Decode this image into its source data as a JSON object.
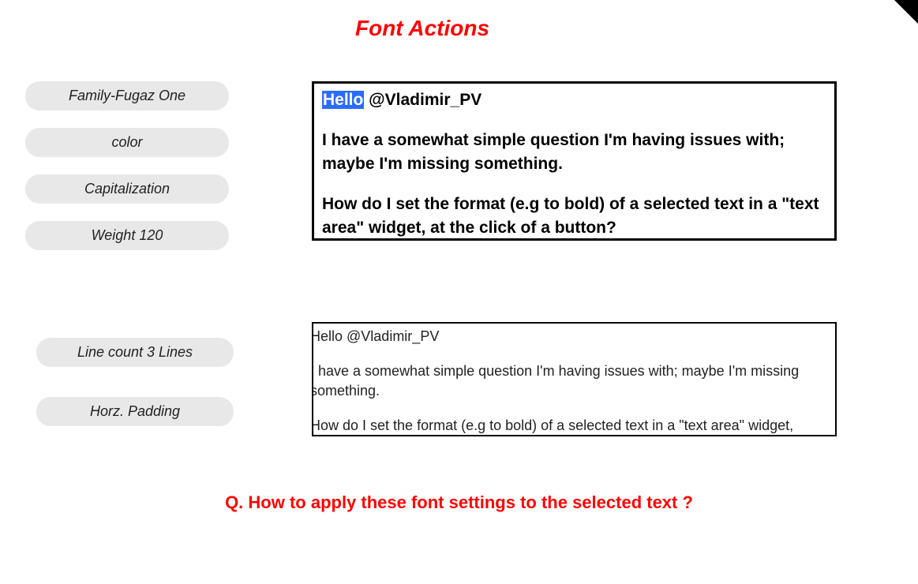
{
  "header": {
    "title": "Font Actions"
  },
  "sidebar_top": {
    "items": [
      {
        "label": "Family-Fugaz One"
      },
      {
        "label": "color"
      },
      {
        "label": "Capitalization"
      },
      {
        "label": "Weight 120"
      }
    ]
  },
  "sidebar_bottom": {
    "items": [
      {
        "label": "Line count 3 Lines"
      },
      {
        "label": "Horz. Padding"
      }
    ]
  },
  "textbox1": {
    "highlighted": "Hello",
    "mention": " @Vladimir_PV",
    "para2": "I have a somewhat simple question I'm having issues with; maybe I'm missing something.",
    "para3": "How do I set the format (e.g to bold) of a selected text in a \"text area\" widget, at the click of a button?"
  },
  "textbox2": {
    "para1": "Hello @Vladimir_PV",
    "para2": "I have a somewhat simple question I'm having issues with; maybe I'm missing something.",
    "para3": "How do I set the format (e.g to bold) of a selected text in a \"text area\" widget,"
  },
  "question": "Q. How to apply these font settings to the selected text ?"
}
